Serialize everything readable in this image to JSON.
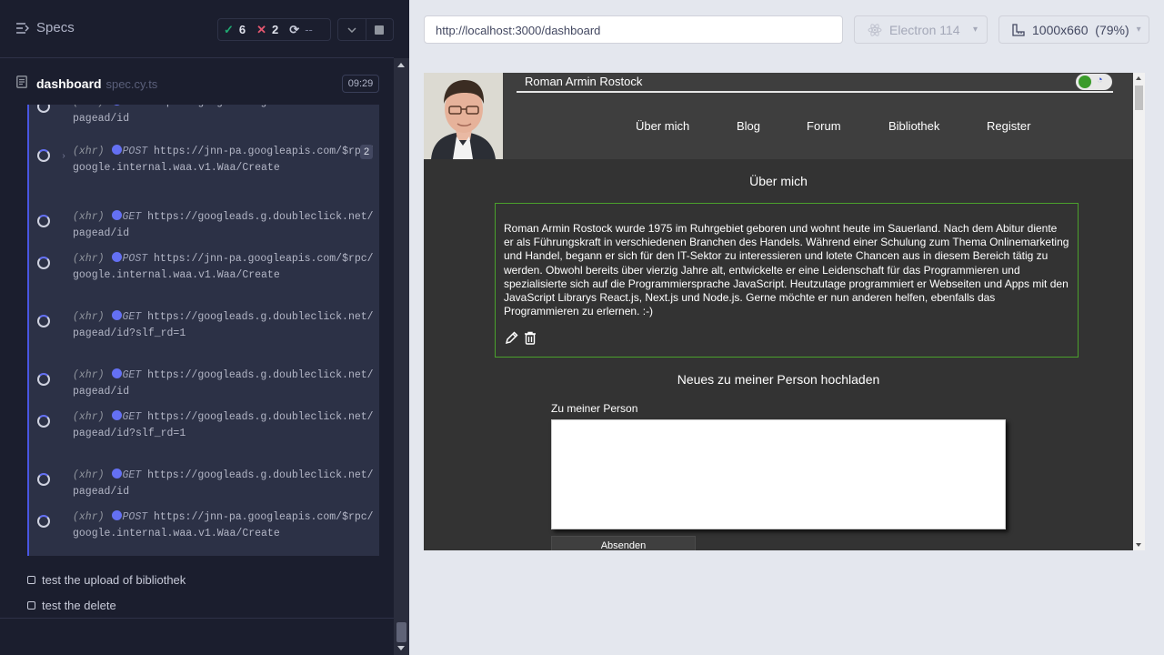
{
  "runner": {
    "specs_label": "Specs",
    "stats": {
      "passed": "6",
      "failed": "2",
      "pending": "--"
    },
    "spec": {
      "name": "dashboard",
      "ext": "spec.cy.ts",
      "time": "09:29"
    },
    "commands": [
      {
        "type": "(xhr)",
        "method": "GET",
        "url": "https://googleads.g.doubleclick.net/pagead/id",
        "badge": ""
      },
      {
        "type": "(xhr)",
        "method": "POST",
        "url": "https://jnn-pa.googleapis.com/$rpc/google.internal.waa.v1.Waa/Create",
        "badge": "2"
      },
      {
        "type": "(xhr)",
        "method": "GET",
        "url": "https://googleads.g.doubleclick.net/pagead/id",
        "badge": ""
      },
      {
        "type": "(xhr)",
        "method": "POST",
        "url": "https://jnn-pa.googleapis.com/$rpc/google.internal.waa.v1.Waa/Create",
        "badge": ""
      },
      {
        "type": "(xhr)",
        "method": "GET",
        "url": "https://googleads.g.doubleclick.net/pagead/id?slf_rd=1",
        "badge": ""
      },
      {
        "type": "(xhr)",
        "method": "GET",
        "url": "https://googleads.g.doubleclick.net/pagead/id",
        "badge": ""
      },
      {
        "type": "(xhr)",
        "method": "GET",
        "url": "https://googleads.g.doubleclick.net/pagead/id?slf_rd=1",
        "badge": ""
      },
      {
        "type": "(xhr)",
        "method": "GET",
        "url": "https://googleads.g.doubleclick.net/pagead/id",
        "badge": ""
      },
      {
        "type": "(xhr)",
        "method": "POST",
        "url": "https://jnn-pa.googleapis.com/$rpc/google.internal.waa.v1.Waa/Create",
        "badge": ""
      }
    ],
    "tests": [
      "test the upload of bibliothek",
      "test the delete"
    ]
  },
  "toolbar": {
    "url": "http://localhost:3000/dashboard",
    "browser": "Electron 114",
    "viewport": "1000x660",
    "zoom": "(79%)"
  },
  "app": {
    "site_name": "Roman Armin Rostock",
    "nav": [
      "Über mich",
      "Blog",
      "Forum",
      "Bibliothek",
      "Register"
    ],
    "about_title": "Über mich",
    "about_text": "Roman Armin Rostock wurde 1975 im Ruhrgebiet geboren und wohnt heute im Sauerland. Nach dem Abitur diente er als Führungskraft in verschiedenen Branchen des Handels. Während einer Schulung zum Thema Onlinemarketing und Handel, begann er sich für den IT-Sektor zu interessieren und lotete Chancen aus in diesem Bereich tätig zu werden. Obwohl bereits über vierzig Jahre alt, entwickelte er eine Leidenschaft für das Programmieren und spezialisierte sich auf die Programmiersprache JavaScript. Heutzutage programmiert er Webseiten und Apps mit den JavaScript Librarys React.js, Next.js und Node.js. Gerne möchte er nun anderen helfen, ebenfalls das Programmieren zu erlernen. :-)",
    "upload_title": "Neues zu meiner Person hochladen",
    "person_label": "Zu meiner Person",
    "person_value": "",
    "submit_label": "Absenden"
  },
  "colors": {
    "accent": "#6470f3",
    "pass": "#1fa971",
    "fail": "#e45770",
    "box_border": "#4ba02c"
  }
}
